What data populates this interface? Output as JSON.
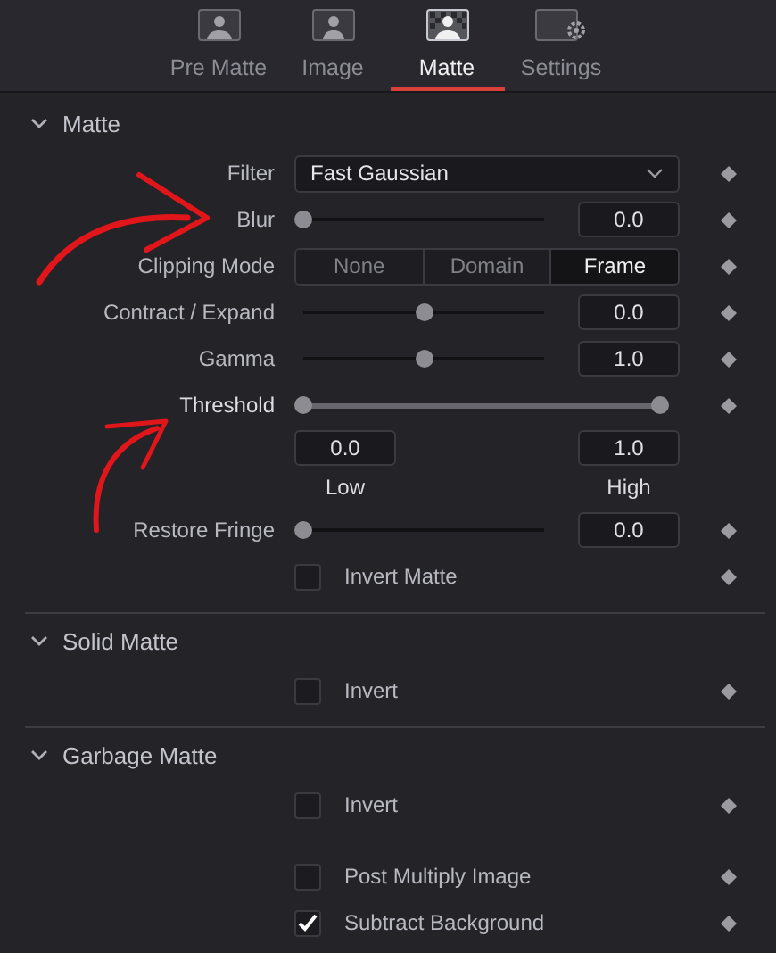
{
  "tabs": [
    {
      "label": "Pre Matte",
      "selected": false
    },
    {
      "label": "Image",
      "selected": false
    },
    {
      "label": "Matte",
      "selected": true
    },
    {
      "label": "Settings",
      "selected": false
    }
  ],
  "sections": [
    {
      "title": "Matte",
      "expanded": true,
      "rows": [
        {
          "kind": "dropdown",
          "label": "Filter",
          "value": "Fast Gaussian"
        },
        {
          "kind": "slider",
          "label": "Blur",
          "level": 0,
          "value": "0.0"
        },
        {
          "kind": "segmented",
          "label": "Clipping Mode",
          "options": [
            {
              "label": "None",
              "selected": false
            },
            {
              "label": "Domain",
              "selected": false
            },
            {
              "label": "Frame",
              "selected": true
            }
          ]
        },
        {
          "kind": "slider",
          "label": "Contract / Expand",
          "level": 0.5,
          "value": "0.0"
        },
        {
          "kind": "slider",
          "label": "Gamma",
          "level": 0.5,
          "value": "1.0"
        },
        {
          "kind": "range",
          "label": "Threshold",
          "thumbs": [
            {
              "level": 0
            },
            {
              "level": 1
            }
          ],
          "low_value": "0.0",
          "high_value": "1.0",
          "low_label": "Low",
          "high_label": "High"
        },
        {
          "kind": "slider",
          "label": "Restore Fringe",
          "level": 0,
          "value": "0.0"
        },
        {
          "kind": "checkbox",
          "label": "Invert Matte",
          "checked": false
        }
      ]
    },
    {
      "title": "Solid Matte",
      "expanded": true,
      "rows": [
        {
          "kind": "checkbox",
          "label": "Invert",
          "checked": false
        }
      ]
    },
    {
      "title": "Garbage Matte",
      "expanded": true,
      "rows": [
        {
          "kind": "checkbox",
          "label": "Invert",
          "checked": false
        },
        {
          "kind": "checkbox",
          "label": "Post Multiply Image",
          "checked": false,
          "gap_before": true
        },
        {
          "kind": "checkbox",
          "label": "Subtract Background",
          "checked": true
        }
      ]
    }
  ]
}
